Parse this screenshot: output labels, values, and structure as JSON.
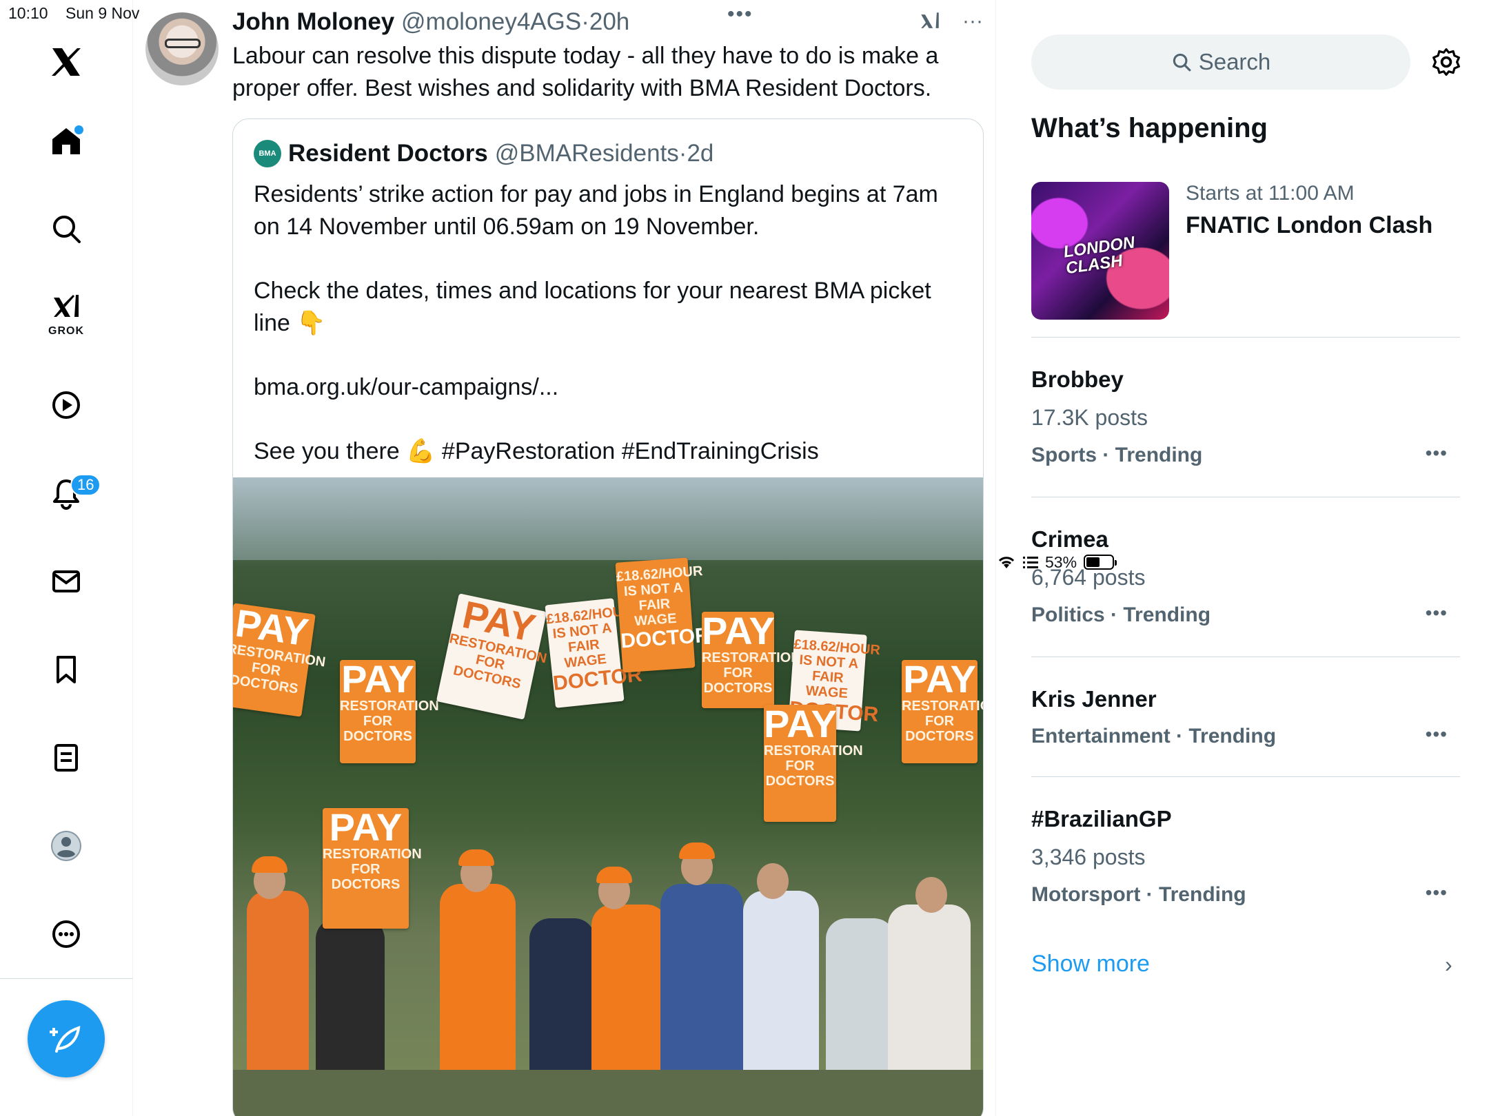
{
  "status": {
    "time": "10:10",
    "date": "Sun 9 Nov",
    "battery": "53%",
    "battery_fraction": 0.53
  },
  "nav": {
    "grok_label": "GROK",
    "notifications_count": "16",
    "items": [
      "x-logo",
      "home-icon",
      "search-icon",
      "grok-icon",
      "video-icon",
      "bell-icon",
      "mail-icon",
      "bookmark-icon",
      "lists-icon",
      "profile-icon",
      "more-icon"
    ]
  },
  "tweet": {
    "name": "John Moloney",
    "handle": "@moloney4AGS",
    "time": "·20h",
    "text": "Labour can resolve this dispute today - all they have to do is make a proper offer. Best wishes and solidarity with BMA Resident Doctors.",
    "quote": {
      "logo": "BMA",
      "name": "Resident Doctors",
      "handle": "@BMAResidents",
      "time": "·2d",
      "p1": "Residents’ strike action for pay and jobs in England begins at 7am on 14 November until 06.59am on 19 November.",
      "p2": "Check the dates, times and locations for your nearest BMA picket line 👇",
      "p3": "bma.org.uk/our-campaigns/...",
      "p4": "See you there 💪 #PayRestoration #EndTrainingCrisis"
    }
  },
  "sidebar": {
    "search_placeholder": "Search",
    "heading": "What’s happening",
    "event": {
      "meta": "Starts at 11:00 AM",
      "title": "FNATIC London Clash",
      "thumb_label": "LONDON CLASH"
    },
    "trends": [
      {
        "name": "Brobbey",
        "posts": "17.3K posts",
        "category": "Sports · Trending"
      },
      {
        "name": "Crimea",
        "posts": "6,764 posts",
        "category": "Politics · Trending"
      },
      {
        "name": "Kris Jenner",
        "posts": "",
        "category": "Entertainment · Trending"
      },
      {
        "name": "#BrazilianGP",
        "posts": "3,346 posts",
        "category": "Motorsport · Trending"
      }
    ],
    "show_more": "Show more"
  },
  "colors": {
    "accent": "#1d9bf0",
    "text": "#0f1419",
    "muted": "#536471",
    "border": "#cfd9de"
  }
}
